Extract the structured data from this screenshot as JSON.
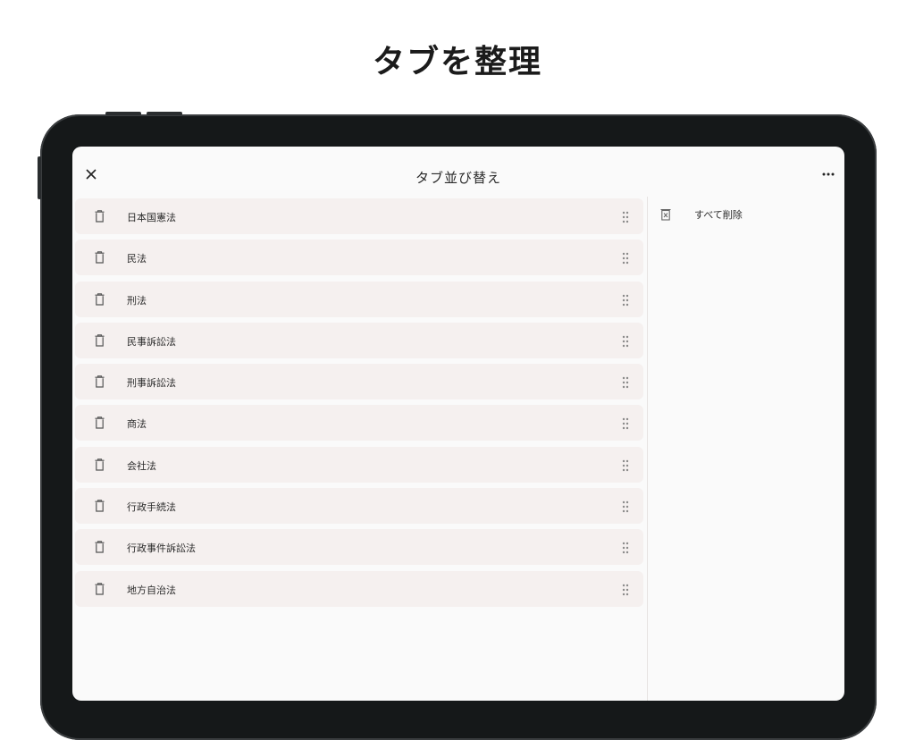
{
  "headline": "タブを整理",
  "screen": {
    "title": "タブ並び替え",
    "close_icon": "close-icon",
    "more_icon": "more-horizontal-icon"
  },
  "tabs": [
    {
      "label": "日本国憲法"
    },
    {
      "label": "民法"
    },
    {
      "label": "刑法"
    },
    {
      "label": "民事訴訟法"
    },
    {
      "label": "刑事訴訟法"
    },
    {
      "label": "商法"
    },
    {
      "label": "会社法"
    },
    {
      "label": "行政手続法"
    },
    {
      "label": "行政事件訴訟法"
    },
    {
      "label": "地方自治法"
    }
  ],
  "side_panel": {
    "delete_all_label": "すべて削除",
    "delete_all_icon": "delete-all-icon"
  },
  "colors": {
    "row_bg": "#f5f0ef",
    "screen_bg": "#fafafa",
    "device_frame": "#151819"
  }
}
